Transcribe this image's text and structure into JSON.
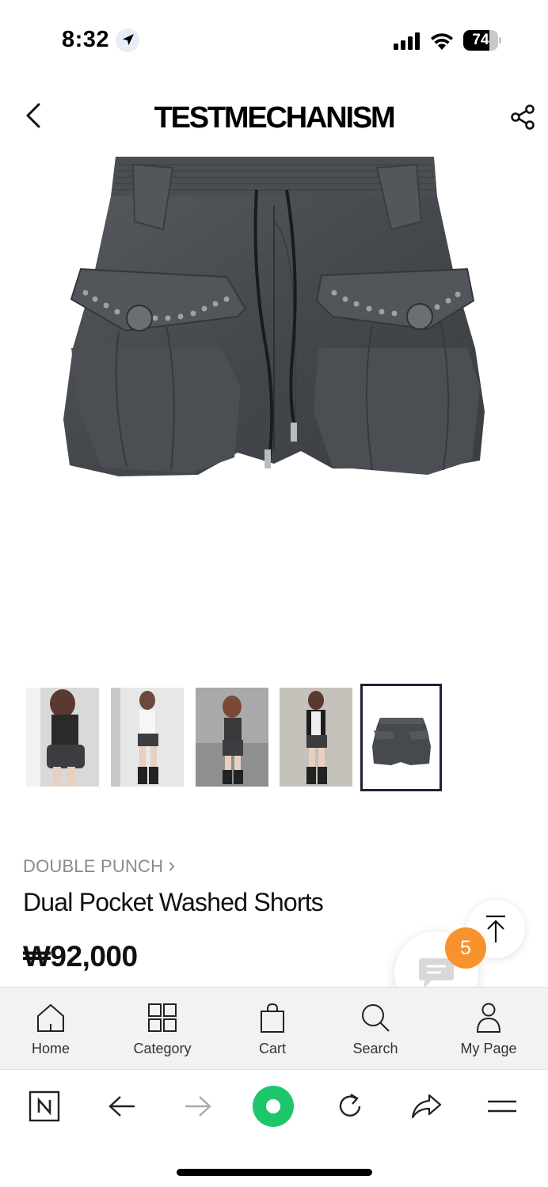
{
  "status_bar": {
    "time": "8:32",
    "battery": "74",
    "battery_level": 0.74,
    "icons": [
      "location-arrow-icon",
      "cellular-signal-icon",
      "wifi-icon",
      "battery-icon"
    ]
  },
  "header": {
    "title": "TESTMECHANISM",
    "back_icon": "chevron-left-icon",
    "share_icon": "share-icon"
  },
  "product_image": {
    "description_icon": "shorts-image"
  },
  "thumbnails": {
    "count": 5,
    "selected_index": 4
  },
  "product": {
    "brand": "DOUBLE PUNCH",
    "brand_arrow": "›",
    "name": "Dual Pocket Washed Shorts",
    "price": "₩92,000"
  },
  "floating": {
    "chat_badge_count": "5",
    "badge_color": "#f7922d"
  },
  "bottom_nav": {
    "items": [
      {
        "label": "Home",
        "icon": "home-icon"
      },
      {
        "label": "Category",
        "icon": "grid-icon"
      },
      {
        "label": "Cart",
        "icon": "shopping-bag-icon"
      },
      {
        "label": "Search",
        "icon": "search-icon"
      },
      {
        "label": "My Page",
        "icon": "user-icon"
      }
    ]
  },
  "browser_bar": {
    "items": [
      "naver-icon",
      "arrow-left-icon",
      "arrow-right-icon",
      "green-dot-icon",
      "refresh-icon",
      "share-arrow-icon",
      "menu-icon"
    ],
    "accent_color": "#1ec66a"
  }
}
